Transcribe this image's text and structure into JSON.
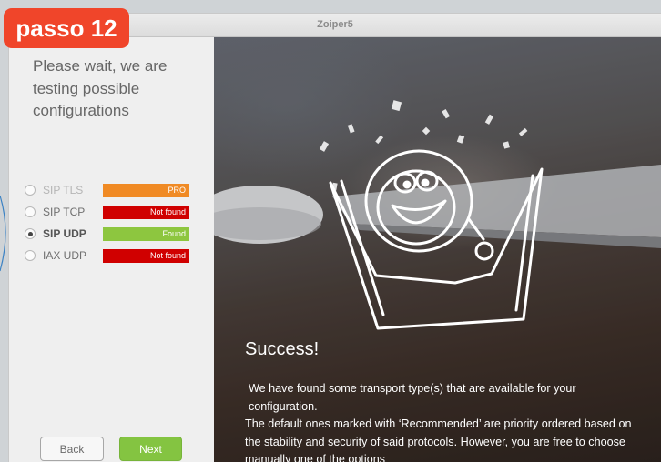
{
  "badge": {
    "label": "passo 12"
  },
  "window": {
    "title": "Zoiper5"
  },
  "left": {
    "wait_text": "Please wait, we are testing possible configurations",
    "protocols": [
      {
        "name": "SIP TLS",
        "status": "PRO",
        "status_color": "#f08a24",
        "selected": false,
        "disabled": true
      },
      {
        "name": "SIP TCP",
        "status": "Not found",
        "status_color": "#d00000",
        "selected": false,
        "disabled": false
      },
      {
        "name": "SIP UDP",
        "status": "Found",
        "status_color": "#8dc63f",
        "selected": true,
        "disabled": false
      },
      {
        "name": "IAX UDP",
        "status": "Not found",
        "status_color": "#d00000",
        "selected": false,
        "disabled": false
      }
    ],
    "back_label": "Back",
    "next_label": "Next"
  },
  "right": {
    "heading": "Success!",
    "paragraphs": [
      "We have found some transport type(s) that are available for your configuration.",
      "The default ones marked with ‘Recommended’ are priority ordered based on the stability and security of said protocols. However, you are free to choose manually one of the options"
    ],
    "illustration": "celebrating-mascot-icon"
  },
  "colors": {
    "accent_green": "#84c441",
    "badge_red": "#f0452a"
  }
}
